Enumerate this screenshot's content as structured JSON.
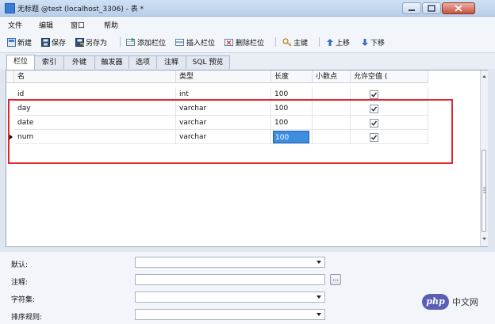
{
  "window": {
    "title": "无标题 @test (localhost_3306) - 表 *"
  },
  "menu": [
    "文件",
    "编辑",
    "窗口",
    "帮助"
  ],
  "toolbar": {
    "new": "新建",
    "save": "保存",
    "save_as": "另存为",
    "add_field": "添加栏位",
    "insert_field": "插入栏位",
    "delete_field": "删除栏位",
    "primary_key": "主键",
    "move_up": "上移",
    "move_down": "下移"
  },
  "tabs": [
    "栏位",
    "索引",
    "外键",
    "触发器",
    "选项",
    "注释",
    "SQL 预览"
  ],
  "grid": {
    "headers": [
      "名",
      "类型",
      "长度",
      "小数点",
      "允许空值 ("
    ],
    "rows": [
      {
        "name": "id",
        "type": "int",
        "length": "100",
        "decimals": "",
        "nullable": true
      },
      {
        "name": "day",
        "type": "varchar",
        "length": "100",
        "decimals": "",
        "nullable": true
      },
      {
        "name": "date",
        "type": "varchar",
        "length": "100",
        "decimals": "",
        "nullable": true
      },
      {
        "name": "num",
        "type": "varchar",
        "length": "100",
        "decimals": "",
        "nullable": true
      }
    ]
  },
  "properties": {
    "default_label": "默认:",
    "comment_label": "注释:",
    "charset_label": "字符集:",
    "collation_label": "排序规则:",
    "dots": "..."
  },
  "watermark": {
    "badge": "php",
    "text": "中文网"
  },
  "colors": {
    "highlight": "#e1262d",
    "selection": "#3d8ee0"
  }
}
